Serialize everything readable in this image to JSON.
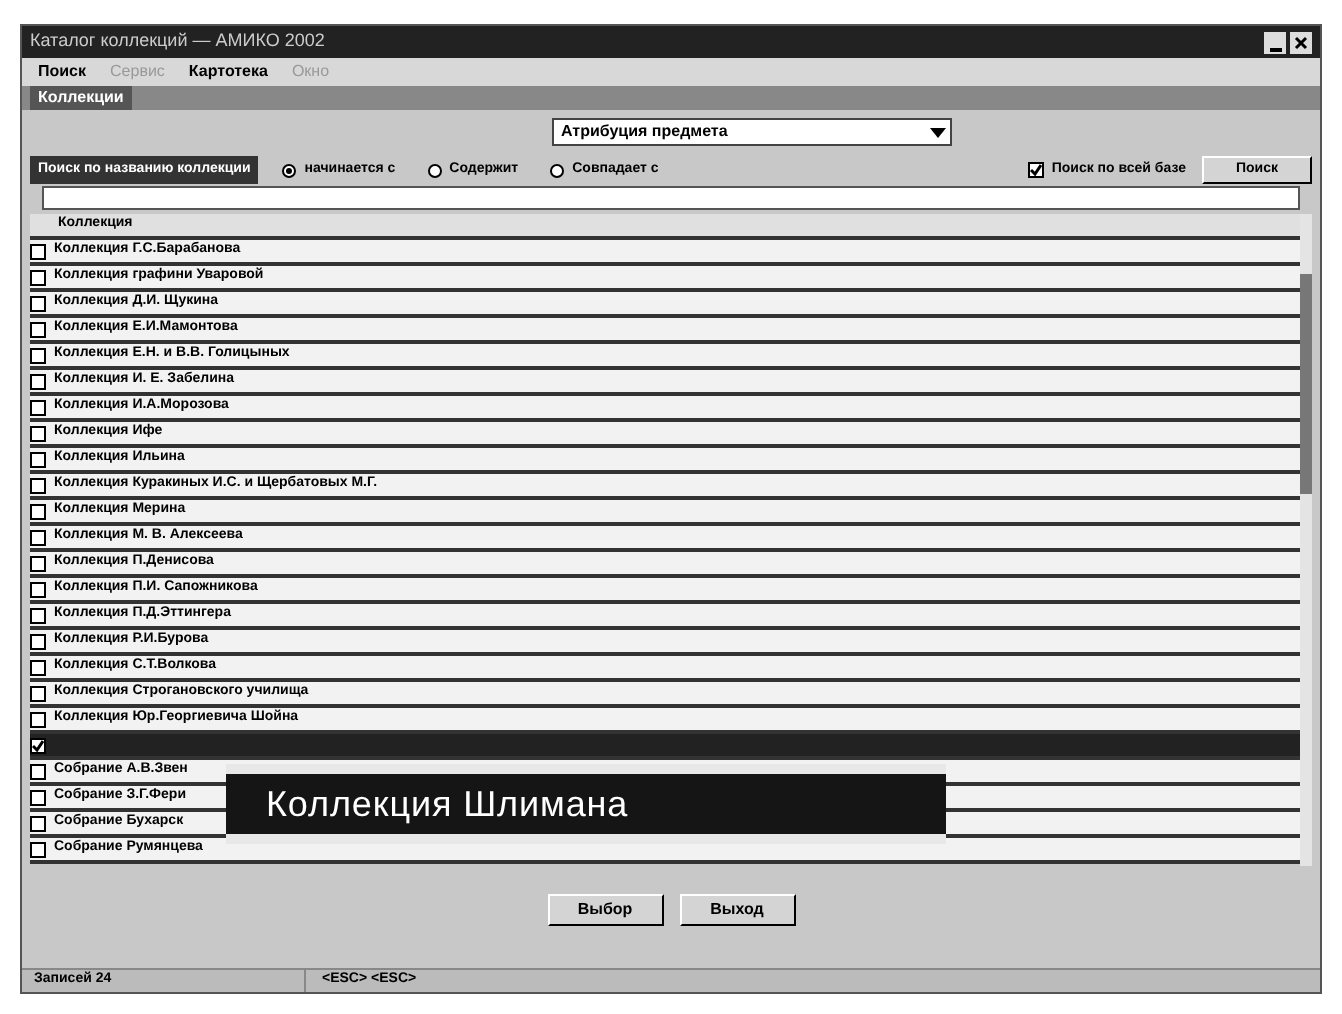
{
  "window": {
    "title": "Каталог коллекций — АМИКО 2002"
  },
  "menu": [
    {
      "label": "Поиск",
      "disabled": false
    },
    {
      "label": "Сервис",
      "disabled": true
    },
    {
      "label": "Картотека",
      "disabled": false
    },
    {
      "label": "Окно",
      "disabled": true
    }
  ],
  "section_label": "Коллекции",
  "dropdown": {
    "value": "Атрибуция предмета"
  },
  "search_label": "Поиск по названию коллекции",
  "match_options": [
    {
      "label": "начинается с",
      "selected": true
    },
    {
      "label": "Содержит",
      "selected": false
    },
    {
      "label": "Совпадает с",
      "selected": false
    }
  ],
  "search_all": {
    "label": "Поиск по всей базе",
    "checked": true
  },
  "search_button": "Поиск",
  "list": {
    "column": "Коллекция",
    "rows": [
      {
        "label": "Коллекция Г.С.Барабанова",
        "checked": false,
        "selected": false
      },
      {
        "label": "Коллекция графини Уваровой",
        "checked": false,
        "selected": false
      },
      {
        "label": "Коллекция Д.И. Щукина",
        "checked": false,
        "selected": false
      },
      {
        "label": "Коллекция Е.И.Мамонтова",
        "checked": false,
        "selected": false
      },
      {
        "label": "Коллекция Е.Н. и В.В. Голицыных",
        "checked": false,
        "selected": false
      },
      {
        "label": "Коллекция И. Е. Забелина",
        "checked": false,
        "selected": false
      },
      {
        "label": "Коллекция И.А.Морозова",
        "checked": false,
        "selected": false
      },
      {
        "label": "Коллекция Ифе",
        "checked": false,
        "selected": false
      },
      {
        "label": "Коллекция Ильина",
        "checked": false,
        "selected": false
      },
      {
        "label": "Коллекция Куракиных И.С. и Щербатовых М.Г.",
        "checked": false,
        "selected": false
      },
      {
        "label": "Коллекция Мерина",
        "checked": false,
        "selected": false
      },
      {
        "label": "Коллекция М. В. Алексеева",
        "checked": false,
        "selected": false
      },
      {
        "label": "Коллекция П.Денисова",
        "checked": false,
        "selected": false
      },
      {
        "label": "Коллекция П.И. Сапожникова",
        "checked": false,
        "selected": false
      },
      {
        "label": "Коллекция П.Д.Эттингера",
        "checked": false,
        "selected": false
      },
      {
        "label": "Коллекция Р.И.Бурова",
        "checked": false,
        "selected": false
      },
      {
        "label": "Коллекция С.Т.Волкова",
        "checked": false,
        "selected": false
      },
      {
        "label": "Коллекция Строгановского училища",
        "checked": false,
        "selected": false
      },
      {
        "label": "Коллекция Юр.Георгиевича Шойна",
        "checked": false,
        "selected": false
      },
      {
        "checked": true,
        "selected": true
      },
      {
        "label": "Собрание А.В.Звен",
        "checked": false,
        "selected": false
      },
      {
        "label": "Собрание З.Г.Фери",
        "checked": false,
        "selected": false
      },
      {
        "label": "Собрание Бухарск",
        "checked": false,
        "selected": false
      },
      {
        "label": "Собрание Румянцева",
        "checked": false,
        "selected": false
      }
    ]
  },
  "callout": "Коллекция Шлимана",
  "buttons": [
    "Выбор",
    "Выход"
  ],
  "status_bar": [
    "Записей 24",
    "<ESC> <ESC>"
  ]
}
